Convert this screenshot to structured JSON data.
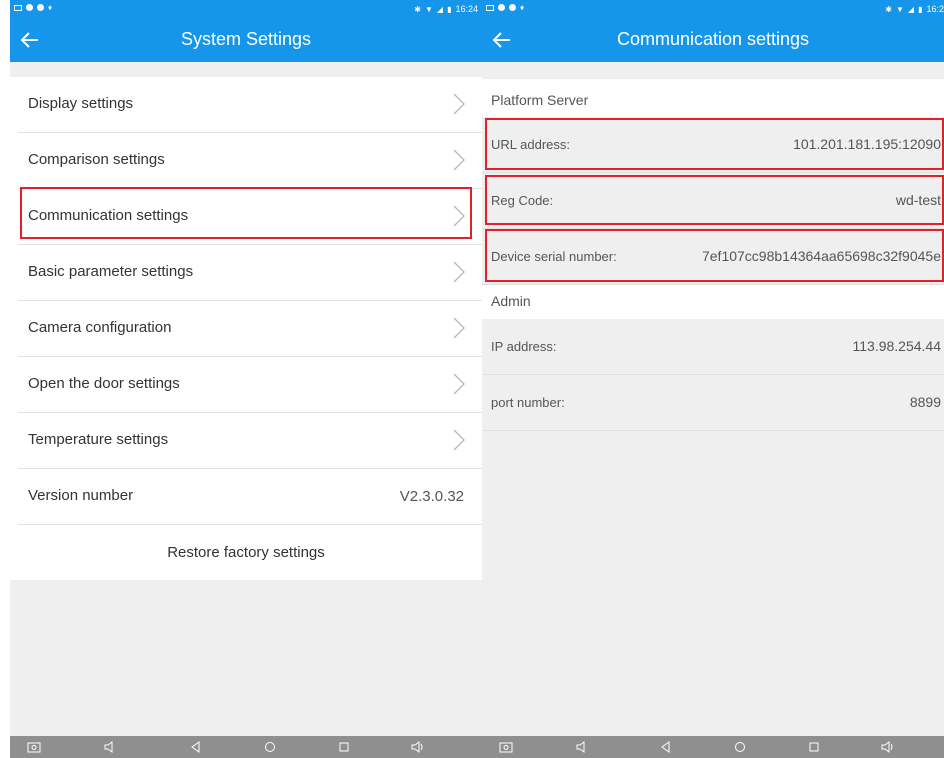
{
  "left_screen": {
    "status_bar": {
      "time": "16:24"
    },
    "app_bar": {
      "title": "System Settings"
    },
    "menu_items": [
      {
        "label": "Display settings"
      },
      {
        "label": "Comparison settings"
      },
      {
        "label": "Communication settings"
      },
      {
        "label": "Basic parameter settings"
      },
      {
        "label": "Camera configuration"
      },
      {
        "label": "Open the door settings"
      },
      {
        "label": "Temperature settings"
      }
    ],
    "version": {
      "label": "Version number",
      "value": "V2.3.0.32"
    },
    "restore_label": "Restore factory settings"
  },
  "right_screen": {
    "status_bar": {
      "time": "16:2"
    },
    "app_bar": {
      "title": "Communication settings"
    },
    "platform_section": "Platform Server",
    "platform_fields": [
      {
        "label": "URL address:",
        "value": "101.201.181.195:12090"
      },
      {
        "label": "Reg Code:",
        "value": "wd-test"
      },
      {
        "label": "Device serial number:",
        "value": "7ef107cc98b14364aa65698c32f9045e"
      }
    ],
    "admin_section": "Admin",
    "admin_fields": [
      {
        "label": "IP address:",
        "value": "113.98.254.44"
      },
      {
        "label": "port number:",
        "value": "8899"
      }
    ]
  },
  "colors": {
    "app_bar": "#1596ea",
    "highlight": "#e0202a",
    "background": "#efefef",
    "nav_bar": "#8f8f8f"
  },
  "icons": [
    "back-arrow-icon",
    "chevron-right-icon",
    "screenshot-icon",
    "volume-down-icon",
    "back-triangle-icon",
    "home-circle-icon",
    "recents-square-icon",
    "volume-up-icon"
  ]
}
